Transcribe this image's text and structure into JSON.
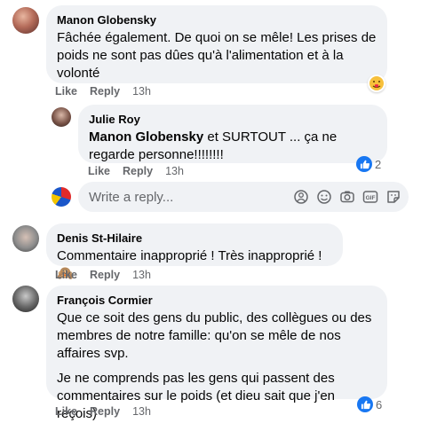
{
  "comments": [
    {
      "author": "Manon Globensky",
      "text": "Fâchée également. De quoi on se mêle! Les prises de poids ne sont pas dûes qu'à l'alimentation et à la volonté",
      "like": "Like",
      "reply": "Reply",
      "time": "13h",
      "reaction_icon": "care-emoji-icon"
    },
    {
      "author": "Julie Roy",
      "mention": "Manon Globensky",
      "text": " et SURTOUT ... ça ne regarde personne!!!!!!!!",
      "like": "Like",
      "reply": "Reply",
      "time": "13h",
      "reaction_count": "2"
    },
    {
      "author": "Denis St-Hilaire",
      "text": "Commentaire inapproprié ! Très inapproprié ! 🙈",
      "like": "Like",
      "reply": "Reply",
      "time": "13h"
    },
    {
      "author": "François Cormier",
      "paragraph1": "Que ce soit des gens du public, des collègues ou des membres de notre famille: qu'on se mêle de nos affaires svp.",
      "paragraph2": "Je ne comprends pas les gens qui passent des commentaires sur le poids (et dieu sait que j'en reçois)",
      "like": "Like",
      "reply": "Reply",
      "time": "13h",
      "reaction_count": "6"
    }
  ],
  "reply_input": {
    "placeholder": "Write a reply..."
  },
  "colors": {
    "bubble": "#f0f2f5",
    "muted": "#65676b",
    "like_blue": "#1877f2"
  }
}
